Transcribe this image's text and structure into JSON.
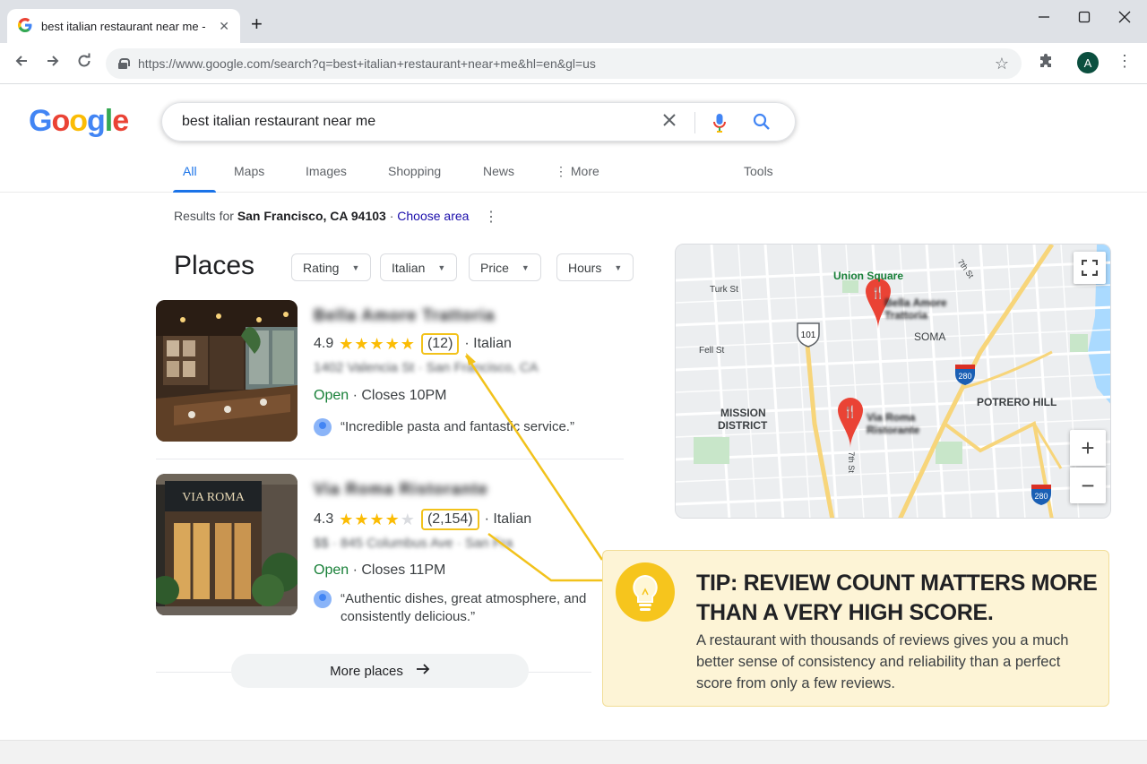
{
  "browser": {
    "tab_title": "best italian restaurant near me -",
    "url": "https://www.google.com/search?q=best+italian+restaurant+near+me&hl=en&gl=us",
    "avatar_letter": "A"
  },
  "google": {
    "logo_letters": [
      "G",
      "o",
      "o",
      "g",
      "l",
      "e"
    ],
    "query": "best italian restaurant near me",
    "tabs": [
      {
        "label": "All",
        "active": true
      },
      {
        "label": "Maps"
      },
      {
        "label": "Images"
      },
      {
        "label": "Shopping"
      },
      {
        "label": "News"
      },
      {
        "label": "More"
      },
      {
        "label": "Tools"
      }
    ],
    "results_for": {
      "prefix": "Results for ",
      "location": "San Francisco, CA 94103",
      "separator": " · ",
      "link": "Choose area"
    }
  },
  "places": {
    "title": "Places",
    "filters": [
      "Rating",
      "Italian",
      "Price",
      "Hours"
    ],
    "items": [
      {
        "name": "Bella Amore Trattoria",
        "rating": "4.9",
        "stars": 5,
        "review_count": "(12)",
        "cuisine": "· Italian",
        "address": "1402 Valencia St · San Francisco, CA",
        "status": "Open",
        "hours": " · Closes 10PM",
        "review": "“Incredible pasta and fantastic service.”"
      },
      {
        "name": "Via Roma Ristorante",
        "rating": "4.3",
        "stars": 4.5,
        "review_count": "(2,154)",
        "cuisine": "· Italian",
        "address": "$$ · 845 Columbus Ave · San Fra",
        "status": "Open",
        "hours": " · Closes 11PM",
        "review": "“Authentic dishes, great atmosphere, and consistently delicious.”",
        "sign": "VIA ROMA"
      }
    ],
    "more_label": "More places"
  },
  "map": {
    "labels": {
      "union_square": "Union Square",
      "turk": "Turk St",
      "fell": "Fell St",
      "mission": "MISSION",
      "district": "DISTRICT",
      "soma": "SOMA",
      "potrero": "POTRERO HILL",
      "seventh_top": "7th St",
      "seventh_bottom": "7th St",
      "hwy101": "101",
      "i280a": "280",
      "i280b": "280",
      "pin1_line1": "Bella Amore",
      "pin1_line2": "Trattoria",
      "pin2_line1": "Via Roma",
      "pin2_line2": "Ristorante"
    }
  },
  "tip": {
    "title": "TIP: REVIEW COUNT MATTERS MORE THAN A VERY HIGH SCORE.",
    "body": "A restaurant with thousands of reviews gives you a much better sense of consistency and reliability than a perfect score from only a few reviews."
  },
  "colors": {
    "google_blue": "#1a73e8",
    "star_yellow": "#fbbc04",
    "highlight_yellow": "#f2c21b",
    "open_green": "#188038",
    "tip_bg": "#fdf4d6",
    "pin_red": "#ea4335"
  }
}
